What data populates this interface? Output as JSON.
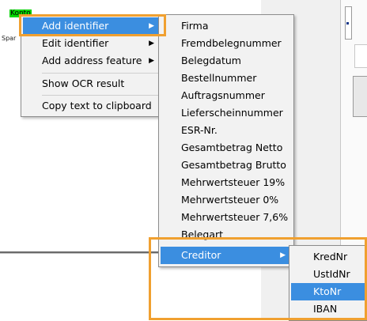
{
  "background": {
    "highlight_tag": "Konto",
    "side_text": "Spar"
  },
  "context_menu": {
    "items": [
      {
        "label": "Add identifier",
        "has_submenu": true,
        "highlighted": true
      },
      {
        "label": "Edit identifier",
        "has_submenu": true
      },
      {
        "label": "Add address feature",
        "has_submenu": true
      },
      {
        "label": "Show OCR result"
      },
      {
        "label": "Copy text to clipboard"
      }
    ],
    "submenu_arrow": "▶"
  },
  "identifier_submenu": {
    "items": [
      {
        "label": "Firma"
      },
      {
        "label": "Fremdbelegnummer"
      },
      {
        "label": "Belegdatum"
      },
      {
        "label": "Bestellnummer"
      },
      {
        "label": "Auftragsnummer"
      },
      {
        "label": "Lieferscheinnummer"
      },
      {
        "label": "ESR-Nr."
      },
      {
        "label": "Gesamtbetrag Netto"
      },
      {
        "label": "Gesamtbetrag Brutto"
      },
      {
        "label": "Mehrwertsteuer 19%"
      },
      {
        "label": "Mehrwertsteuer 0%"
      },
      {
        "label": "Mehrwertsteuer 7,6%"
      },
      {
        "label": "Belegart"
      },
      {
        "label": "Creditor",
        "has_submenu": true,
        "highlighted": true
      }
    ]
  },
  "creditor_submenu": {
    "items": [
      {
        "label": "KredNr"
      },
      {
        "label": "UstIdNr"
      },
      {
        "label": "KtoNr",
        "highlighted": true
      },
      {
        "label": "IBAN"
      }
    ]
  },
  "colors": {
    "highlight": "#3b8ee0",
    "annotation_frame": "#f0a030",
    "menu_bg": "#f2f2f2",
    "tag_green": "#00d600"
  }
}
